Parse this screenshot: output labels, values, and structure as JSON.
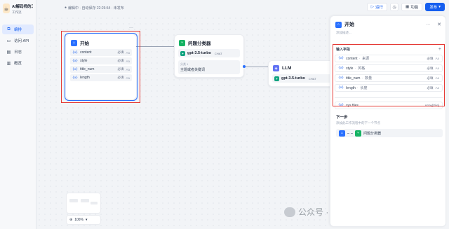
{
  "app": {
    "name": "AI解码师的工作...",
    "subtitle": "工作流"
  },
  "sidebar": {
    "items": [
      {
        "label": "编排",
        "icon": "workflow-icon",
        "active": true
      },
      {
        "label": "访问 API",
        "icon": "terminal-icon",
        "active": false
      },
      {
        "label": "日志",
        "icon": "log-icon",
        "active": false
      },
      {
        "label": "概览",
        "icon": "chart-icon",
        "active": false
      }
    ]
  },
  "topbar": {
    "status": "编辑中 · 自动保存 22:26:54 · 未发布",
    "run_label": "运行",
    "features_label": "功能",
    "publish_label": "发布"
  },
  "canvas": {
    "start_node": {
      "title": "开始",
      "vars": [
        {
          "name": "content",
          "req": "必填",
          "type": "Aa"
        },
        {
          "name": "style",
          "req": "必填",
          "type": "Aa"
        },
        {
          "name": "title_num",
          "req": "必填",
          "type": "Aa"
        },
        {
          "name": "length",
          "req": "必填",
          "type": "Aa"
        }
      ]
    },
    "classifier_node": {
      "title": "问题分类器",
      "model": "gpt-3.5-turbo",
      "model_tag": "CHAT",
      "class_label": "分类 1",
      "class_text": "主题或者关键词"
    },
    "llm_node": {
      "title": "LLM",
      "model": "gpt-3.5-turbo",
      "model_tag": "CHAT"
    },
    "zoom": "106%",
    "watermark": "公众号 · 架构营"
  },
  "panel": {
    "title": "开始",
    "description": "添加描述...",
    "input_section": "输入字段",
    "fields": [
      {
        "name": "content",
        "label": "来源",
        "req": "必填",
        "type": "Aa"
      },
      {
        "name": "style",
        "label": "风格",
        "req": "必填",
        "type": "Aa"
      },
      {
        "name": "title_num",
        "label": "数量",
        "req": "必填",
        "type": "Aa"
      },
      {
        "name": "length",
        "label": "长度",
        "req": "必填",
        "type": "Aa"
      }
    ],
    "sys_field": {
      "name": "sys.files",
      "type": "Array[File]"
    },
    "next_title": "下一步",
    "next_desc": "添加此工作流程中的下一个节点",
    "next_node": "问题分类器"
  },
  "colors": {
    "accent": "#155eef",
    "highlight": "#e53935"
  }
}
